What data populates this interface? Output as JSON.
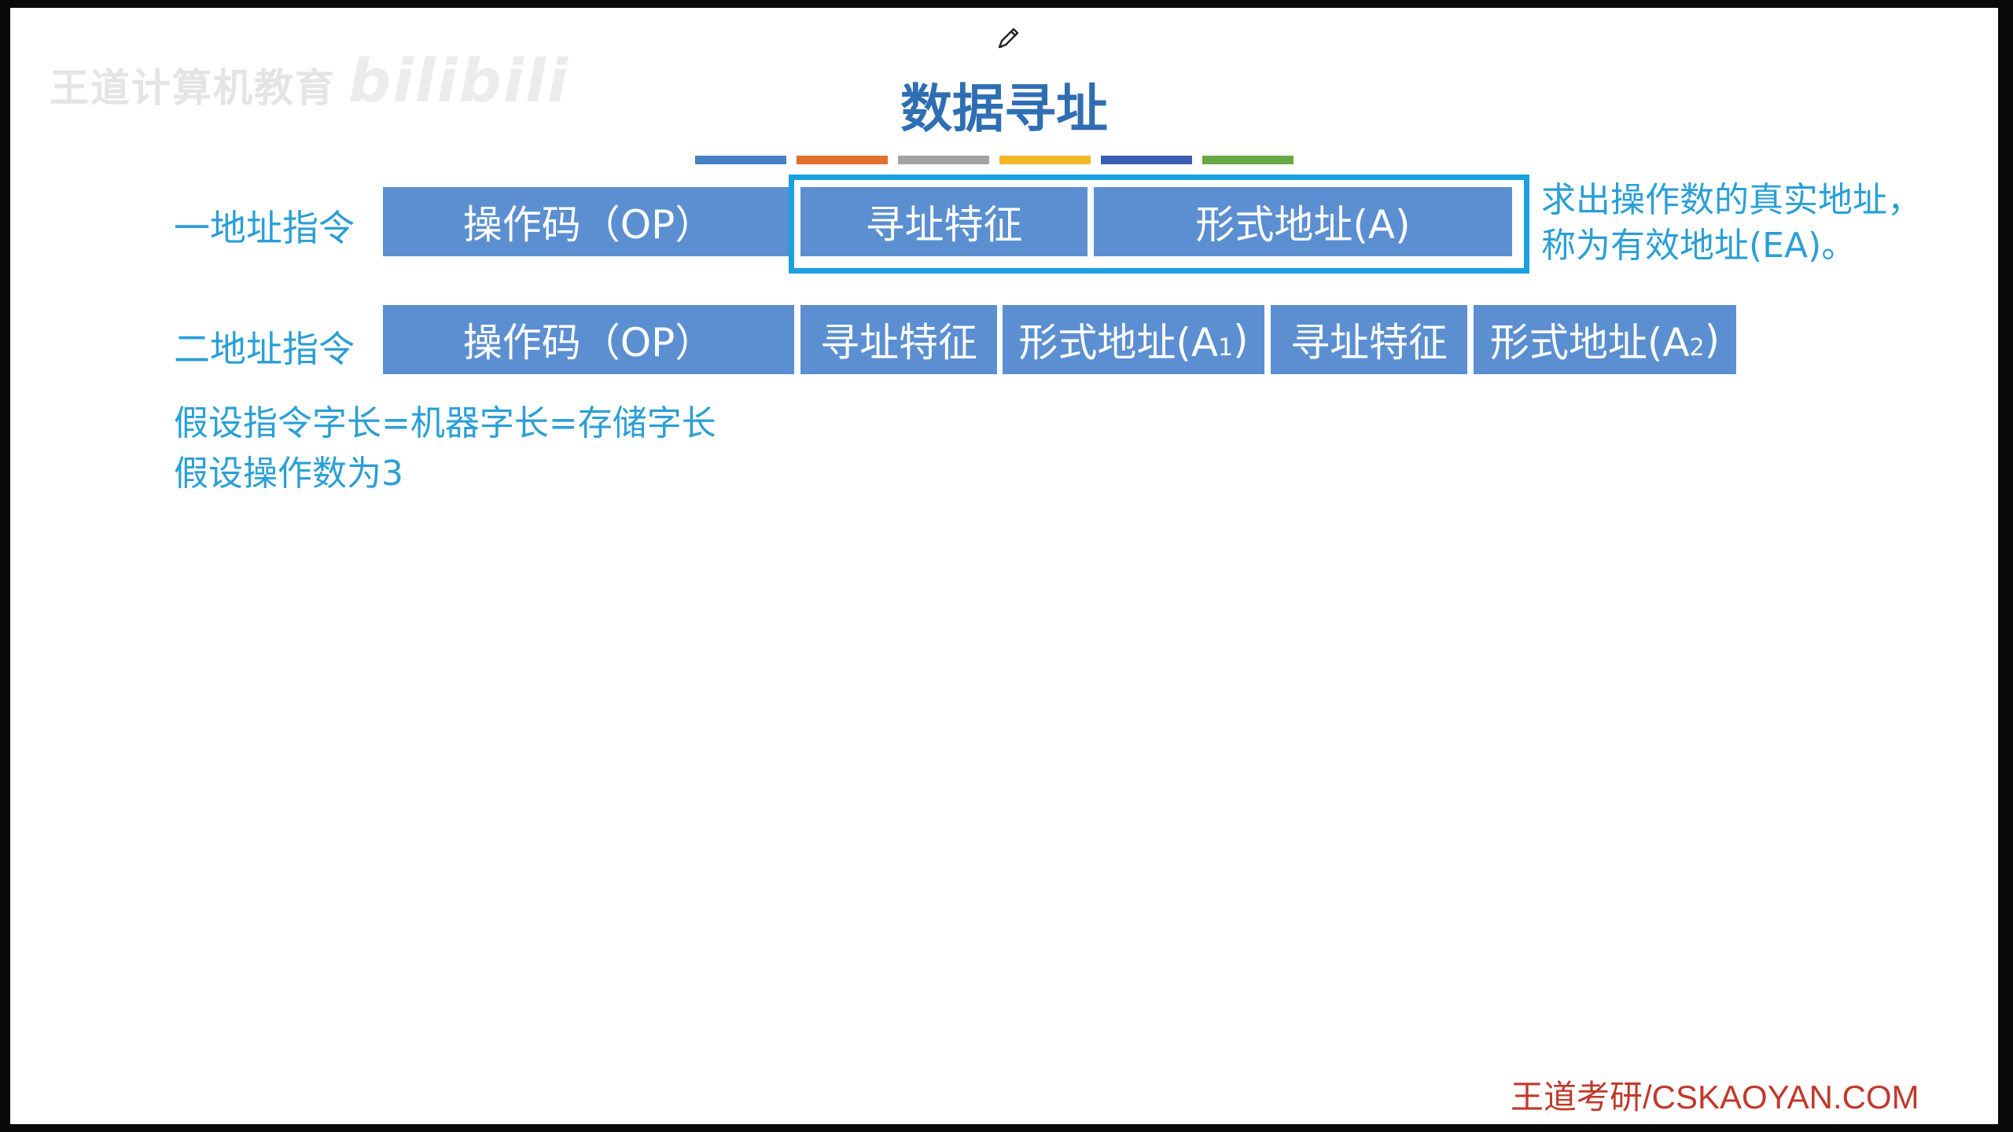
{
  "watermark": {
    "text": "王道计算机教育",
    "brand": "bilibili"
  },
  "toolbar": {
    "pencil_icon": "pencil-icon"
  },
  "slide": {
    "title": "数据寻址",
    "color_bars": [
      "#4a7fc1",
      "#e0702b",
      "#a3a3a3",
      "#f2b826",
      "#3b5fb0",
      "#69a844"
    ],
    "one_address": {
      "label": "一地址指令",
      "opcode": "操作码（OP）",
      "mode": "寻址特征",
      "address": "形式地址(A)"
    },
    "two_address": {
      "label": "二地址指令",
      "opcode": "操作码（OP）",
      "mode1": "寻址特征",
      "address1": "形式地址(A",
      "address1_sub": "1",
      "mode2": "寻址特征",
      "address2": "形式地址(A",
      "address2_sub": "2"
    },
    "close_paren": ")",
    "ea_note": {
      "line1": "求出操作数的真实地址，",
      "line2": "称为有效地址(EA)。"
    },
    "assumptions": [
      "假设指令字长=机器字长=存储字长",
      "假设操作数为3"
    ]
  },
  "footer": {
    "brand": "王道考研/CSKAOYAN.COM"
  },
  "colors": {
    "title": "#2f6eb3",
    "field_bg": "#5b8fd1",
    "label_text": "#2a9fd6",
    "highlight": "#1aa1e0",
    "footer": "#c0392b"
  }
}
